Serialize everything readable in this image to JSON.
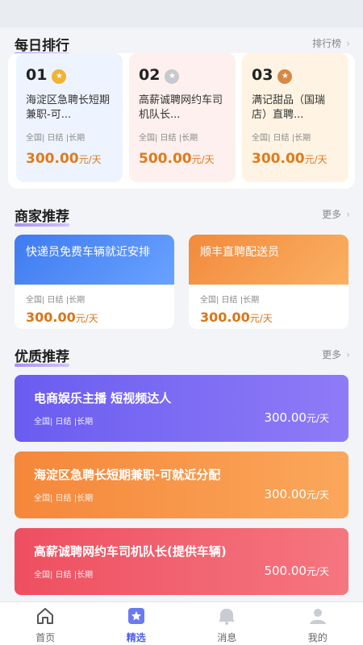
{
  "daily_rank": {
    "title": "每日排行",
    "more": "排行榜"
  },
  "rank_items": [
    {
      "num": "01",
      "title": "海淀区急聘长短期兼职-可...",
      "tags": "全国| 日结 |长期",
      "price": "300.00",
      "unit": "元/天",
      "medal_color": "#f2b233"
    },
    {
      "num": "02",
      "title": "高薪诚聘网约车司机队长...",
      "tags": "全国| 日结 |长期",
      "price": "500.00",
      "unit": "元/天",
      "medal_color": "#c7c9cf"
    },
    {
      "num": "03",
      "title": "满记甜品（国瑞店）直聘...",
      "tags": "全国| 日结 |长期",
      "price": "300.00",
      "unit": "元/天",
      "medal_color": "#d88845"
    }
  ],
  "merchant": {
    "title": "商家推荐",
    "more": "更多"
  },
  "merchant_items": [
    {
      "title": "快递员免费车辆就近安排",
      "tags": "全国| 日结 |长期",
      "price": "300.00",
      "unit": "元/天",
      "color": "#4a86f0"
    },
    {
      "title": "顺丰直聘配送员",
      "tags": "全国| 日结 |长期",
      "price": "300.00",
      "unit": "元/天",
      "color": "#f59a45"
    }
  ],
  "quality": {
    "title": "优质推荐",
    "more": "更多"
  },
  "quality_items": [
    {
      "title": "电商娱乐主播 短视频达人",
      "tags": "全国| 日结 |长期",
      "price": "300.00",
      "unit": "元/天",
      "color": "#7a68f2"
    },
    {
      "title": "海淀区急聘长短期兼职-可就近分配",
      "tags": "全国| 日结 |长期",
      "price": "300.00",
      "unit": "元/天",
      "color": "#f79341"
    },
    {
      "title": "高薪诚聘网约车司机队长(提供车辆)",
      "tags": "全国| 日结 |长期",
      "price": "500.00",
      "unit": "元/天",
      "color": "#ef5863"
    }
  ],
  "tabs": [
    {
      "label": "首页",
      "icon": "home-icon"
    },
    {
      "label": "精选",
      "icon": "star-icon"
    },
    {
      "label": "消息",
      "icon": "message-icon"
    },
    {
      "label": "我的",
      "icon": "profile-icon"
    }
  ],
  "accent": "#4d63e6"
}
